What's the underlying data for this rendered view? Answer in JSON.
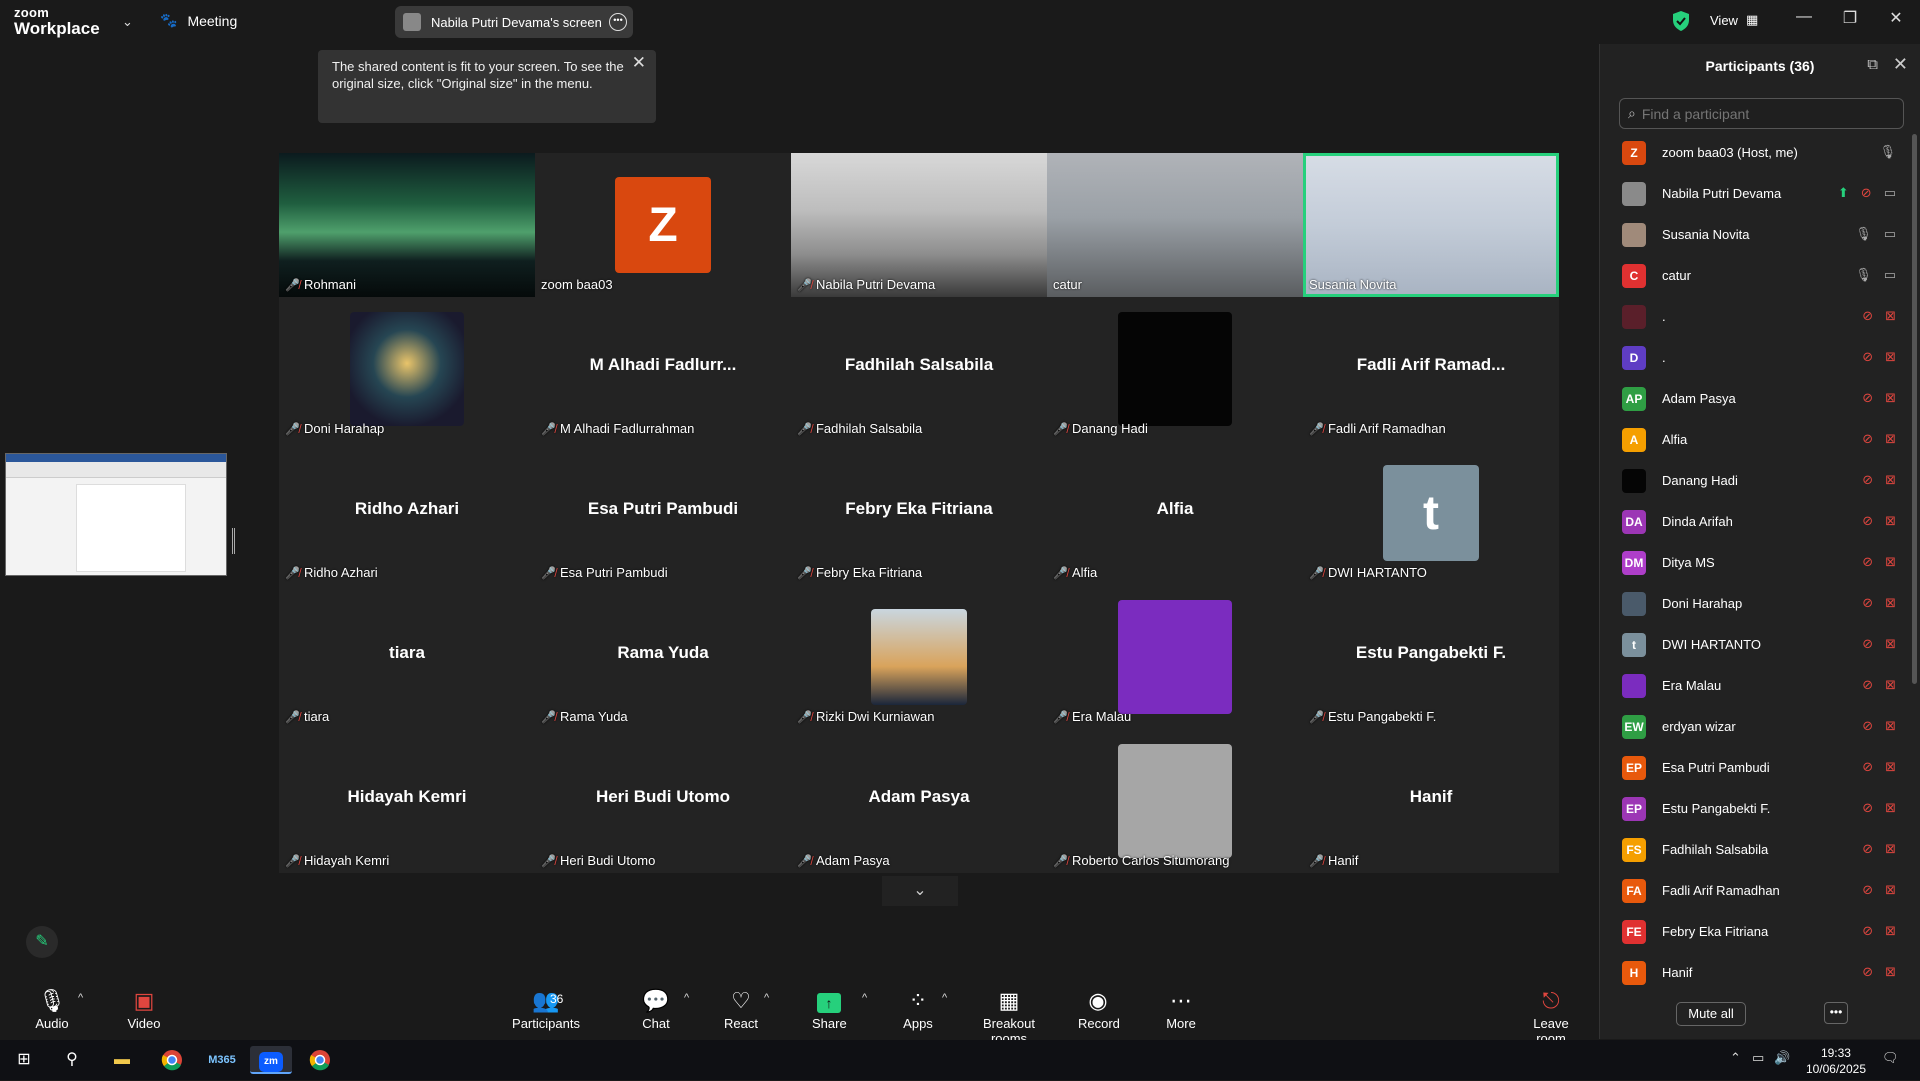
{
  "topbar": {
    "brand_line1": "zoom",
    "brand_line2": "Workplace",
    "meeting_label": "Meeting",
    "screen_share_label": "Nabila Putri Devama's screen",
    "view_label": "View"
  },
  "tooltip": {
    "text": "The shared content is fit to your screen. To see the original size, click \"Original size\" in the menu."
  },
  "tiles": [
    {
      "label": "Rohmani",
      "big": "",
      "type": "aurora",
      "mic_off": true
    },
    {
      "label": "zoom baa03",
      "big": "",
      "type": "letter",
      "letter": "Z",
      "color": "#d9480f",
      "mic_off": false
    },
    {
      "label": "Nabila Putri Devama",
      "big": "",
      "type": "blur",
      "mic_off": true
    },
    {
      "label": "catur",
      "big": "",
      "type": "video2",
      "mic_off": false
    },
    {
      "label": "Susania Novita",
      "big": "",
      "type": "video3",
      "mic_off": false,
      "active": true
    },
    {
      "label": "Doni Harahap",
      "big": "",
      "type": "photo",
      "mic_off": true
    },
    {
      "label": "M Alhadi Fadlurrahman",
      "big": "M Alhadi Fadlurr...",
      "type": "name",
      "mic_off": true
    },
    {
      "label": "Fadhilah Salsabila",
      "big": "Fadhilah Salsabila",
      "type": "name",
      "mic_off": true
    },
    {
      "label": "Danang Hadi",
      "big": "",
      "type": "dark",
      "mic_off": true
    },
    {
      "label": "Fadli Arif Ramadhan",
      "big": "Fadli Arif Ramad...",
      "type": "name",
      "mic_off": true
    },
    {
      "label": "Ridho Azhari",
      "big": "Ridho Azhari",
      "type": "name",
      "mic_off": true
    },
    {
      "label": "Esa Putri Pambudi",
      "big": "Esa Putri Pambudi",
      "type": "name",
      "mic_off": true
    },
    {
      "label": "Febry Eka Fitriana",
      "big": "Febry Eka Fitriana",
      "type": "name",
      "mic_off": true
    },
    {
      "label": "Alfia",
      "big": "Alfia",
      "type": "name",
      "mic_off": true
    },
    {
      "label": "DWI HARTANTO",
      "big": "",
      "type": "letter",
      "letter": "t",
      "color": "#7b909c",
      "mic_off": true
    },
    {
      "label": "tiara",
      "big": "tiara",
      "type": "name",
      "mic_off": true
    },
    {
      "label": "Rama Yuda",
      "big": "Rama Yuda",
      "type": "name",
      "mic_off": true
    },
    {
      "label": "Rizki Dwi Kurniawan",
      "big": "",
      "type": "photo2",
      "mic_off": true
    },
    {
      "label": "Era Malau",
      "big": "",
      "type": "purple",
      "mic_off": true
    },
    {
      "label": "Estu Pangabekti F.",
      "big": "Estu Pangabekti F.",
      "type": "name",
      "mic_off": true
    },
    {
      "label": "Hidayah Kemri",
      "big": "Hidayah Kemri",
      "type": "name",
      "mic_off": true
    },
    {
      "label": "Heri Budi Utomo",
      "big": "Heri Budi Utomo",
      "type": "name",
      "mic_off": true
    },
    {
      "label": "Adam Pasya",
      "big": "Adam Pasya",
      "type": "name",
      "mic_off": true
    },
    {
      "label": "Roberto Carlos Situmorang",
      "big": "",
      "type": "gray",
      "mic_off": true
    },
    {
      "label": "Hanif",
      "big": "Hanif",
      "type": "name",
      "mic_off": true
    }
  ],
  "panel": {
    "title": "Participants (36)",
    "search_placeholder": "Find a participant",
    "mute_all": "Mute all",
    "participants": [
      {
        "name": "zoom baa03 (Host, me)",
        "initials": "Z",
        "color": "#d9480f",
        "status": "mic-on"
      },
      {
        "name": "Nabila Putri Devama",
        "initials": "",
        "color": "#8a8a8a",
        "status": "sharing"
      },
      {
        "name": "Susania Novita",
        "initials": "",
        "color": "#a08a7a",
        "status": "mic-cam-on"
      },
      {
        "name": "catur",
        "initials": "C",
        "color": "#e03131",
        "status": "mic-cam-on"
      },
      {
        "name": ".",
        "initials": "",
        "color": "#5a1f2a",
        "status": "off"
      },
      {
        "name": ".",
        "initials": "D",
        "color": "#5f3dc4",
        "status": "off"
      },
      {
        "name": "Adam Pasya",
        "initials": "AP",
        "color": "#2f9e44",
        "status": "off"
      },
      {
        "name": "Alfia",
        "initials": "A",
        "color": "#f59f00",
        "status": "off"
      },
      {
        "name": "Danang Hadi",
        "initials": "",
        "color": "#050505",
        "status": "off"
      },
      {
        "name": "Dinda Arifah",
        "initials": "DA",
        "color": "#9c36b5",
        "status": "off"
      },
      {
        "name": "Ditya MS",
        "initials": "DM",
        "color": "#ae3ec9",
        "status": "off"
      },
      {
        "name": "Doni Harahap",
        "initials": "",
        "color": "#4a5a6a",
        "status": "off"
      },
      {
        "name": "DWI HARTANTO",
        "initials": "t",
        "color": "#7b909c",
        "status": "off"
      },
      {
        "name": "Era Malau",
        "initials": "",
        "color": "#7b2cbf",
        "status": "off"
      },
      {
        "name": "erdyan wizar",
        "initials": "EW",
        "color": "#2f9e44",
        "status": "off"
      },
      {
        "name": "Esa Putri Pambudi",
        "initials": "EP",
        "color": "#e8590c",
        "status": "off"
      },
      {
        "name": "Estu Pangabekti F.",
        "initials": "EP",
        "color": "#9c36b5",
        "status": "off"
      },
      {
        "name": "Fadhilah Salsabila",
        "initials": "FS",
        "color": "#f59f00",
        "status": "off"
      },
      {
        "name": "Fadli Arif Ramadhan",
        "initials": "FA",
        "color": "#e8590c",
        "status": "off"
      },
      {
        "name": "Febry Eka Fitriana",
        "initials": "FE",
        "color": "#e03131",
        "status": "off"
      },
      {
        "name": "Hanif",
        "initials": "H",
        "color": "#e8590c",
        "status": "off"
      }
    ]
  },
  "toolbar": {
    "audio": "Audio",
    "video": "Video",
    "participants": "Participants",
    "participants_count": "36",
    "chat": "Chat",
    "react": "React",
    "share": "Share",
    "apps": "Apps",
    "breakout": "Breakout rooms",
    "record": "Record",
    "more": "More",
    "leave": "Leave room"
  },
  "taskbar": {
    "time": "19:33",
    "date": "10/06/2025",
    "m365_label": "M365",
    "zoom_label": "zm"
  }
}
